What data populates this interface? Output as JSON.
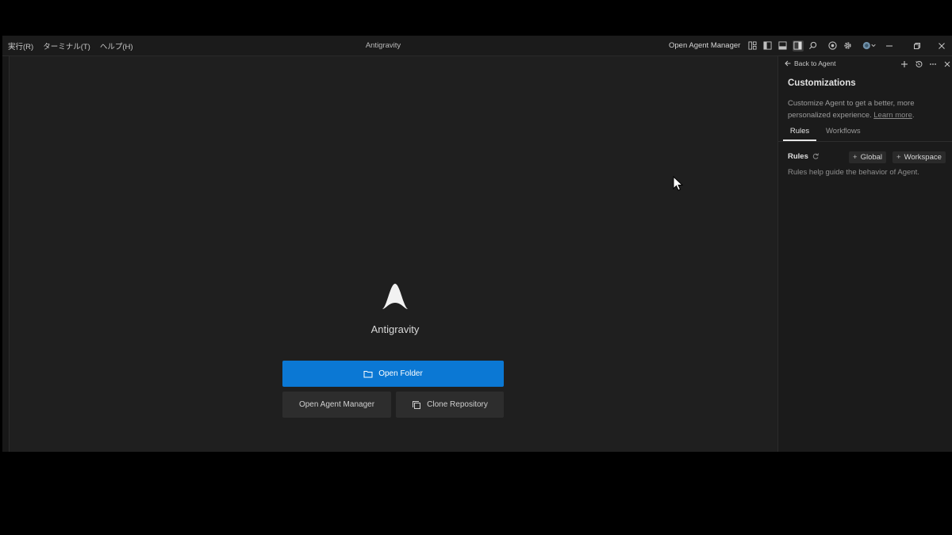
{
  "menu": {
    "items": [
      "実行(R)",
      "ターミナル(T)",
      "ヘルプ(H)"
    ]
  },
  "titlebar": {
    "app_title": "Antigravity",
    "open_agent_manager": "Open Agent Manager"
  },
  "welcome": {
    "title": "Antigravity",
    "open_folder": "Open Folder",
    "open_agent_manager": "Open Agent Manager",
    "clone_repository": "Clone Repository"
  },
  "panel": {
    "back_label": "Back to Agent",
    "title": "Customizations",
    "description": "Customize Agent to get a better, more personalized experience.",
    "learn_more": "Learn more",
    "tabs": [
      "Rules",
      "Workflows"
    ],
    "rules_label": "Rules",
    "add_global": "Global",
    "add_workspace": "Workspace",
    "rules_help": "Rules help guide the behavior of Agent."
  },
  "colors": {
    "primary_button": "#0b78d4",
    "background": "#1f1f1f",
    "panel_background": "#1b1b1b"
  },
  "icons": {
    "title_bar": [
      "layout-icon",
      "sidebar-left-icon",
      "panel-bottom-icon",
      "sidebar-right-icon",
      "search-icon",
      "chrome-icon",
      "gear-icon",
      "account-icon"
    ],
    "window": [
      "minimize-icon",
      "restore-icon",
      "close-icon"
    ],
    "panel": [
      "back-arrow-icon",
      "plus-icon",
      "history-icon",
      "more-icon",
      "close-icon"
    ]
  }
}
